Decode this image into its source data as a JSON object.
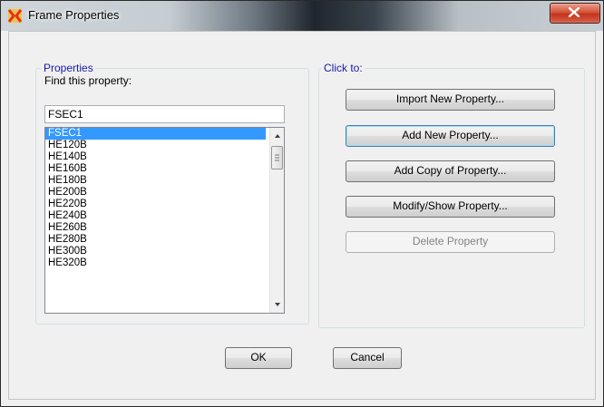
{
  "window": {
    "title": "Frame Properties",
    "app_icon": "app-icon",
    "close_icon": "close-icon"
  },
  "properties_group": {
    "title": "Properties",
    "find_label": "Find this property:",
    "find_value": "FSEC1",
    "list_items": [
      "FSEC1",
      "HE120B",
      "HE140B",
      "HE160B",
      "HE180B",
      "HE200B",
      "HE220B",
      "HE240B",
      "HE260B",
      "HE280B",
      "HE300B",
      "HE320B"
    ],
    "selected_item": "FSEC1"
  },
  "click_to_group": {
    "title": "Click to:",
    "buttons": {
      "import": "Import New Property...",
      "add_new": "Add New Property...",
      "add_copy": "Add Copy of Property...",
      "modify_show": "Modify/Show Property...",
      "delete": "Delete Property"
    }
  },
  "footer": {
    "ok": "OK",
    "cancel": "Cancel"
  },
  "colors": {
    "selection": "#3399ff",
    "group_title": "#1a1aa0",
    "close_button": "#c2341b"
  }
}
